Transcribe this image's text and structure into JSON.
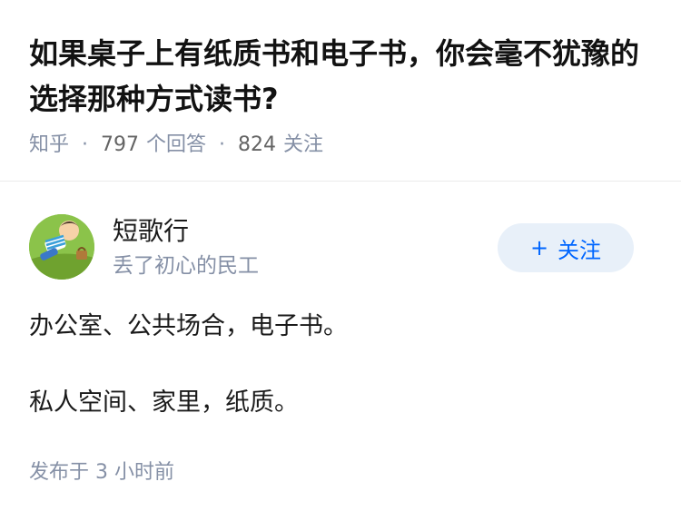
{
  "question": {
    "title": "如果桌子上有纸质书和电子书，你会毫不犹豫的选择那种方式读书?",
    "source": "知乎",
    "answer_count": "797",
    "answer_count_label": "个回答",
    "follower_count": "824",
    "follower_count_label": "关注",
    "separator": "·"
  },
  "author": {
    "name": "短歌行",
    "headline": "丢了初心的民工",
    "avatar_icon": "cartoon-boy-avatar-icon",
    "follow_plus": "+",
    "follow_label": "关注"
  },
  "answer": {
    "lines": [
      "办公室、公共场合，电子书。",
      "私人空间、家里，纸质。"
    ],
    "time": "发布于 3 小时前"
  },
  "colors": {
    "title": "#121212",
    "meta": "#8590a6",
    "follow_bg": "#e8f0f9",
    "follow_text": "#0066ff",
    "avatar_bg": "#8bc34a"
  }
}
